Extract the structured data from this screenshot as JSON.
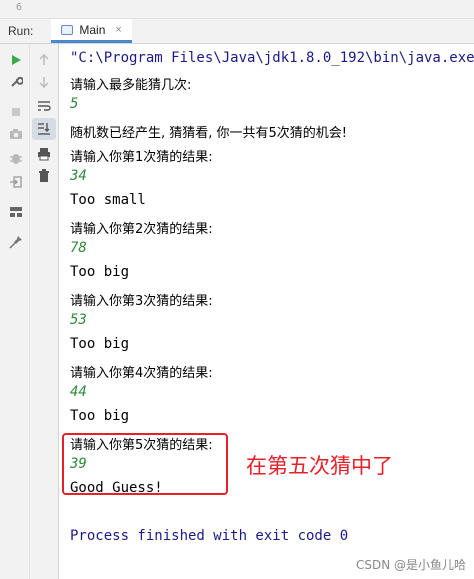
{
  "editor": {
    "line_number": "6"
  },
  "run_panel": {
    "run_label": "Run:",
    "tab_label": "Main",
    "tab_close": "×"
  },
  "toolbar": {
    "icons": [
      "play-icon",
      "wrench-icon",
      "stop-icon",
      "camera-icon",
      "debug-icon",
      "login-icon",
      "layout-icon",
      "pin-icon",
      "up-arrow-icon",
      "down-arrow-icon",
      "soft-wrap-icon",
      "scroll-to-end-icon",
      "print-icon",
      "trash-icon"
    ],
    "colors": {
      "play": "#3daa4a",
      "active_toggle": "#d6dce6"
    }
  },
  "console": {
    "command": "\"C:\\Program Files\\Java\\jdk1.8.0_192\\bin\\java.exe\"",
    "lines": [
      {
        "text": "请输入最多能猜几次:",
        "kind": "cjk"
      },
      {
        "text": "5",
        "kind": "input"
      },
      {
        "text": "随机数已经产生, 猜猜看, 你一共有5次猜的机会!",
        "kind": "cjk"
      },
      {
        "text": "请输入你第1次猜的结果:",
        "kind": "cjk"
      },
      {
        "text": "34",
        "kind": "input"
      },
      {
        "text": "Too small",
        "kind": "out"
      },
      {
        "text": "请输入你第2次猜的结果:",
        "kind": "cjk"
      },
      {
        "text": "78",
        "kind": "input"
      },
      {
        "text": "Too big",
        "kind": "out"
      },
      {
        "text": "请输入你第3次猜的结果:",
        "kind": "cjk"
      },
      {
        "text": "53",
        "kind": "input"
      },
      {
        "text": "Too big",
        "kind": "out"
      },
      {
        "text": "请输入你第4次猜的结果:",
        "kind": "cjk"
      },
      {
        "text": "44",
        "kind": "input"
      },
      {
        "text": "Too big",
        "kind": "out"
      },
      {
        "text": "请输入你第5次猜的结果:",
        "kind": "cjk"
      },
      {
        "text": "39",
        "kind": "input"
      },
      {
        "text": "Good Guess!",
        "kind": "out"
      }
    ],
    "exit_message": "Process finished with exit code 0",
    "colors": {
      "input": "#2d8a3d",
      "command": "#1a1a8a"
    }
  },
  "annotation": {
    "text": "在第五次猜中了",
    "color": "#e8202a"
  },
  "watermark": "CSDN @是小鱼儿哈"
}
